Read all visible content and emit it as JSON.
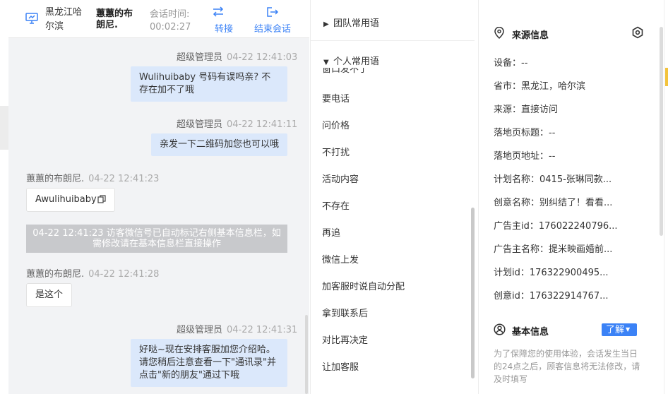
{
  "header": {
    "location": "黑龙江哈尔滨",
    "customer_name": "蕙蕙的布朗尼.",
    "duration_label": "会话时间:",
    "duration_value": "00:02:27",
    "transfer_label": "转接",
    "end_label": "结束会话"
  },
  "messages": [
    {
      "sender": "超级管理员",
      "time": "04-22 12:41:03",
      "text": "Wulihuibaby  号码有误吗亲?  不存在加不了哦"
    },
    {
      "sender": "超级管理员",
      "time": "04-22 12:41:11",
      "text": "亲发一下二维码加您也可以哦"
    },
    {
      "sender": "蕙蕙的布朗尼.",
      "time": "04-22 12:41:23",
      "text": "Awulihuibaby"
    },
    {
      "system_note": "04-22 12:41:23 访客微信号已自动标记右侧基本信息栏，如需修改请在基本信息栏直接操作"
    },
    {
      "sender": "蕙蕙的布朗尼.",
      "time": "04-22 12:41:28",
      "text": "是这个"
    },
    {
      "sender": "超级管理员",
      "time": "04-22 12:41:31",
      "text": "好哒~现在安排客服加您介绍哈。请您稍后注意查看一下\"通讯录\"并点击\"新的朋友\"通过下哦"
    }
  ],
  "phrases": {
    "team_group": "团队常用语",
    "personal_group": "个人常用语",
    "clipped_item": "窗口发不了",
    "items": [
      "要电话",
      "问价格",
      "不打扰",
      "活动内容",
      "不存在",
      "再追",
      "微信上发",
      "加客服时说自动分配",
      "拿到联系后",
      "对比再决定",
      "让加客服"
    ]
  },
  "source_info": {
    "title": "来源信息",
    "rows": [
      {
        "key": "设备：",
        "value": "--"
      },
      {
        "key": "省市：",
        "value": "黑龙江，哈尔滨"
      },
      {
        "key": "来源：",
        "value": "直接访问"
      },
      {
        "key": "落地页标题：",
        "value": "--"
      },
      {
        "key": "落地页地址：",
        "value": "--"
      },
      {
        "key": "计划名称：",
        "value": "0415-张琳同款..."
      },
      {
        "key": "创意名称：",
        "value": "别纠结了！看看..."
      },
      {
        "key": "广告主id：",
        "value": "176022240796..."
      },
      {
        "key": "广告主名称：",
        "value": "提米映画婚前..."
      },
      {
        "key": "计划id：",
        "value": "176322900495..."
      },
      {
        "key": "创意id：",
        "value": "176322914767..."
      }
    ]
  },
  "basic_info": {
    "title": "基本信息",
    "learn_label": "了解",
    "notice": "为了保障您的使用体验，会话发生当日的24点之后，顾客信息将无法修改，请及时填写"
  },
  "colors": {
    "accent": "#3b82f6",
    "bubble_agent": "#dbe8fb",
    "chat_bg": "#f2f3f5",
    "system_note_bg": "#c8c9cc"
  }
}
